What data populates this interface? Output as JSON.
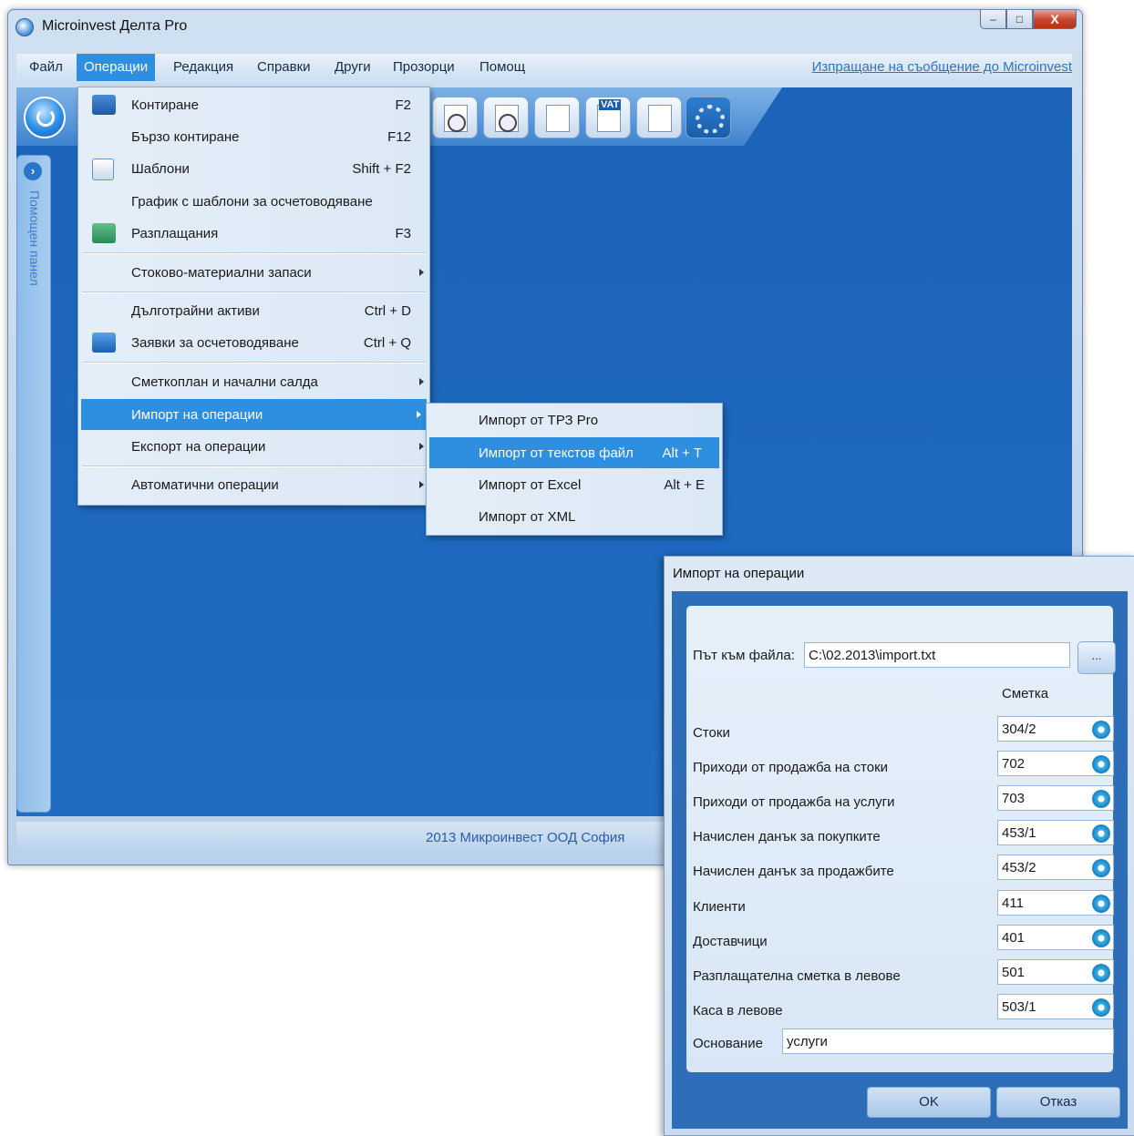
{
  "window": {
    "title": "Microinvest Делта Pro",
    "buttons": {
      "minimize": "–",
      "maximize": "□",
      "close": "X"
    }
  },
  "menubar": {
    "items": [
      {
        "label": "Файл"
      },
      {
        "label": "Операции"
      },
      {
        "label": "Редакция"
      },
      {
        "label": "Справки"
      },
      {
        "label": "Други"
      },
      {
        "label": "Прозорци"
      },
      {
        "label": "Помощ"
      }
    ],
    "feedback_link": "Изпращане на съобщение до Microinvest"
  },
  "toolbar": {
    "vat_label": "VAT",
    "icons": [
      "power-icon",
      "clock-globe-icon",
      "document-clock-icon",
      "person-document-icon",
      "vat-document-icon",
      "calendar-document-icon",
      "settings-gear-icon"
    ]
  },
  "side_panel": {
    "label": "Помощен панел"
  },
  "status": {
    "text": "2013   Микроинвест ООД   София"
  },
  "operations_menu": {
    "items": [
      {
        "label": "Контиране",
        "shortcut": "F2"
      },
      {
        "label": "Бързо контиране",
        "shortcut": "F12"
      },
      {
        "label": "Шаблони",
        "shortcut": "Shift + F2"
      },
      {
        "label": "График с шаблони за осчетоводяване",
        "shortcut": ""
      },
      {
        "label": "Разплащания",
        "shortcut": "F3"
      },
      {
        "label": "Стоково-материални запаси",
        "shortcut": ""
      },
      {
        "label": "Дълготрайни активи",
        "shortcut": "Ctrl + D"
      },
      {
        "label": "Заявки за осчетоводяване",
        "shortcut": "Ctrl + Q"
      },
      {
        "label": "Сметкоплан и начални салда",
        "shortcut": ""
      },
      {
        "label": "Импорт на операции",
        "shortcut": ""
      },
      {
        "label": "Експорт на операции",
        "shortcut": ""
      },
      {
        "label": "Автоматични операции",
        "shortcut": ""
      }
    ]
  },
  "import_submenu": {
    "items": [
      {
        "label": "Импорт от ТРЗ Pro",
        "shortcut": ""
      },
      {
        "label": "Импорт от текстов файл",
        "shortcut": "Alt + T"
      },
      {
        "label": "Импорт от Excel",
        "shortcut": "Alt + E"
      },
      {
        "label": "Импорт от XML",
        "shortcut": ""
      }
    ]
  },
  "dialog": {
    "title": "Импорт на операции",
    "file_label": "Път към файла:",
    "file_path": "C:\\02.2013\\import.txt",
    "browse_label": "...",
    "account_header": "Сметка",
    "rows": [
      {
        "label": "Стоки",
        "account": "304/2"
      },
      {
        "label": "Приходи от продажба на стоки",
        "account": "702"
      },
      {
        "label": "Приходи от продажба на услуги",
        "account": "703"
      },
      {
        "label": "Начислен данък за покупките",
        "account": "453/1"
      },
      {
        "label": "Начислен данък за продажбите",
        "account": "453/2"
      },
      {
        "label": "Клиенти",
        "account": "411"
      },
      {
        "label": "Доставчици",
        "account": "401"
      },
      {
        "label": "Разплащателна сметка в левове",
        "account": "501"
      },
      {
        "label": "Каса в левове",
        "account": "503/1"
      }
    ],
    "basis_label": "Основание",
    "basis_value": "услуги",
    "ok_label": "OK",
    "cancel_label": "Отказ"
  }
}
